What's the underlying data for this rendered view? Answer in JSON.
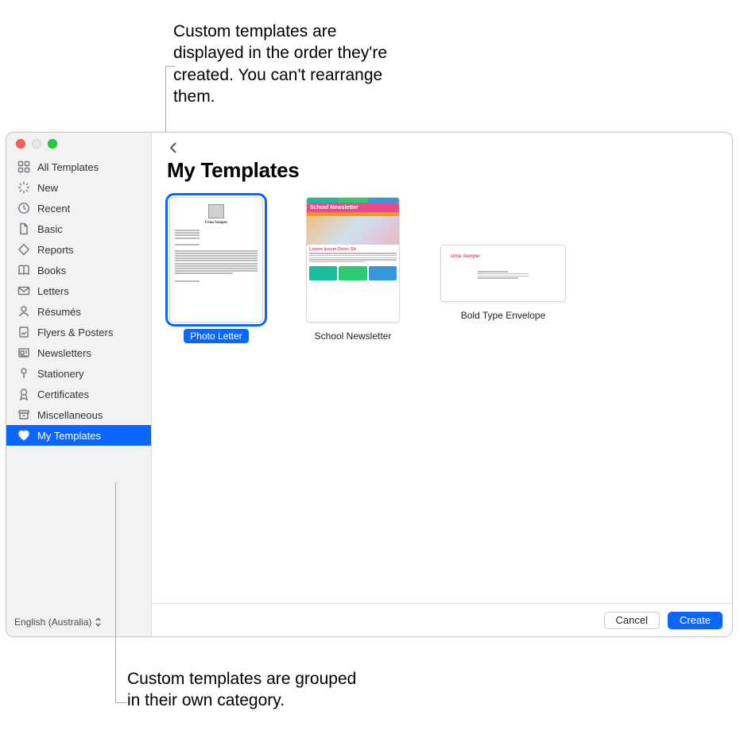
{
  "callouts": {
    "top": "Custom templates are displayed in the order they're created. You can't rearrange them.",
    "bottom": "Custom templates are grouped in their own category."
  },
  "sidebar": {
    "items": [
      {
        "label": "All Templates",
        "icon": "grid-icon"
      },
      {
        "label": "New",
        "icon": "sparkle-icon"
      },
      {
        "label": "Recent",
        "icon": "clock-icon"
      },
      {
        "label": "Basic",
        "icon": "document-icon"
      },
      {
        "label": "Reports",
        "icon": "diamond-icon"
      },
      {
        "label": "Books",
        "icon": "book-icon"
      },
      {
        "label": "Letters",
        "icon": "envelope-icon"
      },
      {
        "label": "Résumés",
        "icon": "person-icon"
      },
      {
        "label": "Flyers & Posters",
        "icon": "poster-icon"
      },
      {
        "label": "Newsletters",
        "icon": "newspaper-icon"
      },
      {
        "label": "Stationery",
        "icon": "pin-icon"
      },
      {
        "label": "Certificates",
        "icon": "ribbon-icon"
      },
      {
        "label": "Miscellaneous",
        "icon": "archive-icon"
      },
      {
        "label": "My Templates",
        "icon": "heart-icon",
        "selected": true
      }
    ],
    "language": "English (Australia)"
  },
  "main": {
    "title": "My Templates",
    "templates": [
      {
        "label": "Photo Letter",
        "selected": true,
        "kind": "letter",
        "dummy_name": "Urna Semper"
      },
      {
        "label": "School Newsletter",
        "selected": false,
        "kind": "newsletter",
        "headline": "School Newsletter",
        "subheadline": "Lorem Ipsum Dolor Sit"
      },
      {
        "label": "Bold Type Envelope",
        "selected": false,
        "kind": "envelope",
        "dummy_name": "Urna Semper"
      }
    ]
  },
  "footer": {
    "cancel": "Cancel",
    "create": "Create"
  }
}
